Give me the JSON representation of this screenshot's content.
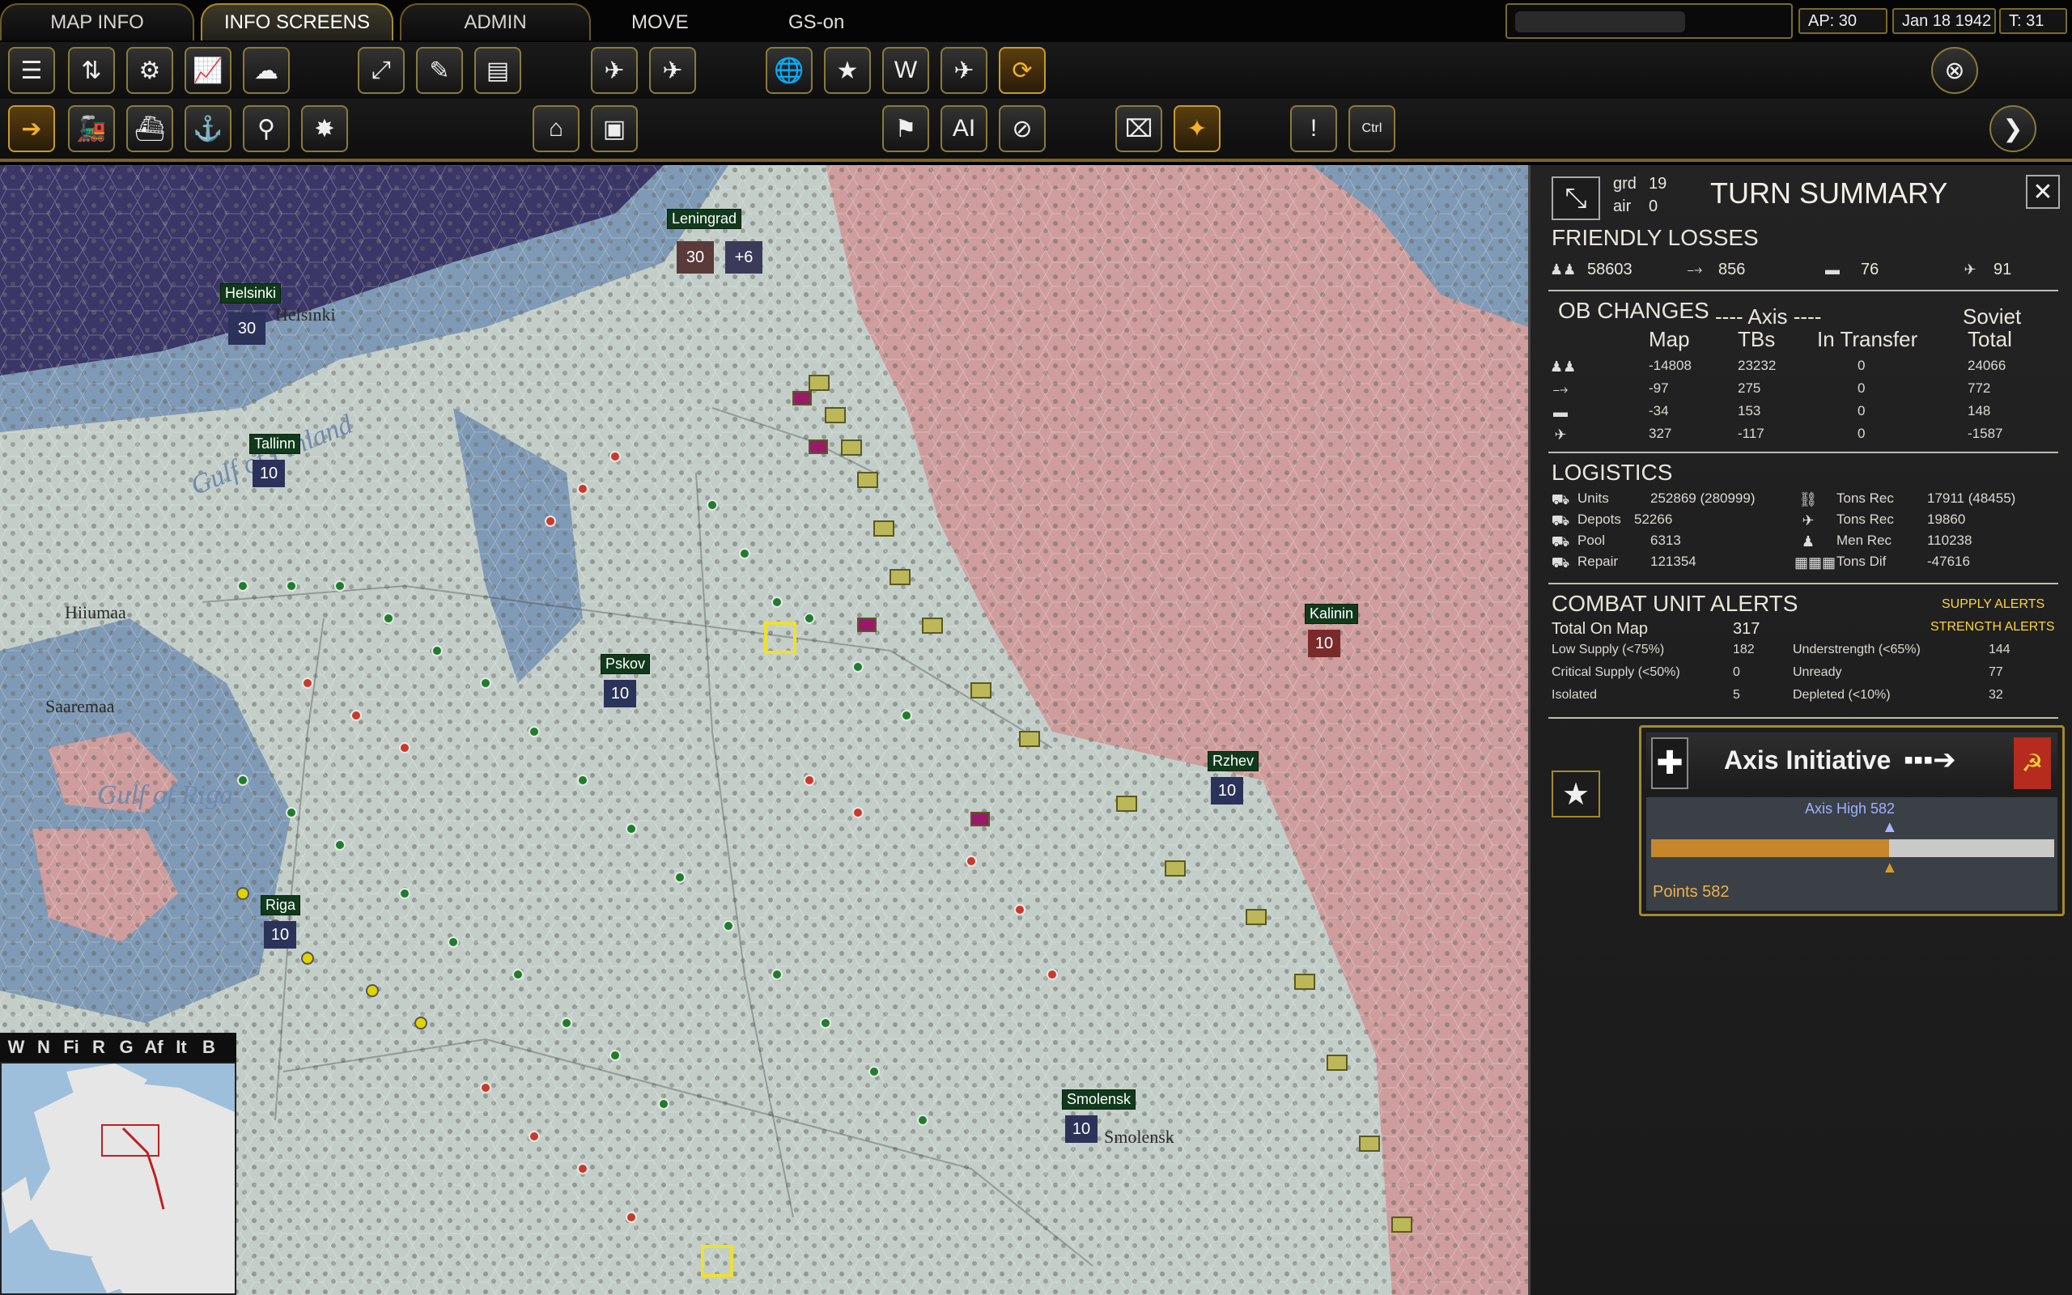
{
  "topbar": {
    "tabs": [
      {
        "label": "MAP INFO"
      },
      {
        "label": "INFO SCREENS"
      },
      {
        "label": "ADMIN"
      }
    ],
    "menus": [
      {
        "label": "MOVE"
      },
      {
        "label": "GS-on"
      }
    ],
    "status": {
      "ap": "AP: 30",
      "date": "Jan 18 1942",
      "turn": "T: 31"
    }
  },
  "map": {
    "cities": [
      {
        "name": "Leningrad",
        "badges": [
          "30",
          "+6"
        ]
      },
      {
        "name": "Helsinki",
        "badges": [
          "30"
        ]
      },
      {
        "name": "Tallinn",
        "badges": [
          "10"
        ]
      },
      {
        "name": "Pskov",
        "badges": [
          "10"
        ]
      },
      {
        "name": "Kalinin",
        "badges": [
          "10"
        ]
      },
      {
        "name": "Rzhev",
        "badges": [
          "10"
        ]
      },
      {
        "name": "Riga",
        "badges": [
          "10"
        ]
      },
      {
        "name": "Smolensk",
        "badges": [
          "10"
        ]
      }
    ],
    "sea_names": [
      "Gulf of Finland",
      "Gulf of Riga"
    ],
    "town_names": [
      "Helsinki",
      "Hiiumaa",
      "Saaremaa",
      "Smolensk"
    ]
  },
  "minimap_tabs": [
    "W",
    "N",
    "Fi",
    "R",
    "G",
    "Af",
    "It",
    "B"
  ],
  "summary": {
    "grd_label": "grd",
    "grd_value": "19",
    "air_label": "air",
    "air_value": "0",
    "title": "TURN SUMMARY",
    "friendly_losses": {
      "heading": "FRIENDLY LOSSES",
      "values": [
        "58603",
        "856",
        "76",
        "91"
      ]
    },
    "ob_changes": {
      "heading": "OB CHANGES",
      "axis_heading": "---- Axis ----",
      "soviet_heading": "Soviet",
      "columns": [
        "Map",
        "TBs",
        "In Transfer",
        "Total"
      ],
      "rows": [
        {
          "map": "-14808",
          "tbs": "23232",
          "transfer": "0",
          "total": "24066"
        },
        {
          "map": "-97",
          "tbs": "275",
          "transfer": "0",
          "total": "772"
        },
        {
          "map": "-34",
          "tbs": "153",
          "transfer": "0",
          "total": "148"
        },
        {
          "map": "327",
          "tbs": "-117",
          "transfer": "0",
          "total": "-1587"
        }
      ]
    },
    "logistics": {
      "heading": "LOGISTICS",
      "left": [
        {
          "label": "Units",
          "value": "252869 (280999)"
        },
        {
          "label": "Depots",
          "value": "52266"
        },
        {
          "label": "Pool",
          "value": "6313"
        },
        {
          "label": "Repair",
          "value": "121354"
        }
      ],
      "right": [
        {
          "label": "Tons Rec",
          "value": "17911 (48455)"
        },
        {
          "label": "Tons Rec",
          "value": "19860"
        },
        {
          "label": "Men Rec",
          "value": "110238"
        },
        {
          "label": "Tons Dif",
          "value": "-47616"
        }
      ]
    },
    "alerts": {
      "heading": "COMBAT UNIT ALERTS",
      "supply_alerts": "SUPPLY ALERTS",
      "strength_alerts": "STRENGTH ALERTS",
      "total_label": "Total On Map",
      "total_value": "317",
      "left": [
        {
          "label": "Low Supply (<75%)",
          "value": "182"
        },
        {
          "label": "Critical Supply (<50%)",
          "value": "0"
        },
        {
          "label": "Isolated",
          "value": "5"
        }
      ],
      "right": [
        {
          "label": "Understrength (<65%)",
          "value": "144"
        },
        {
          "label": "Unready",
          "value": "77"
        },
        {
          "label": "Depleted (<10%)",
          "value": "32"
        }
      ]
    },
    "initiative": {
      "title": "Axis Initiative",
      "high_label": "Axis High 582",
      "points_label": "Points 582",
      "level": 0.59
    }
  },
  "colors": {
    "accent_gold": "#a68b2c",
    "initiative_fill": "#c6862a",
    "alert_yellow": "#ffd43a",
    "soviet_red": "#b52b1e"
  }
}
